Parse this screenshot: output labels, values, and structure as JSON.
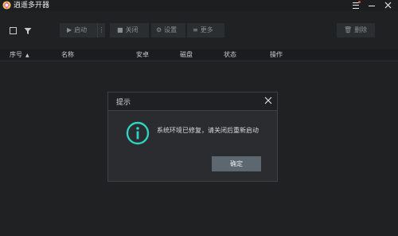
{
  "app": {
    "title": "逍遥多开器"
  },
  "toolbar": {
    "start_label": "启动",
    "close_label": "关闭",
    "settings_label": "设置",
    "more_label": "更多",
    "delete_label": "删除"
  },
  "table": {
    "columns": [
      "序号",
      "名称",
      "安卓",
      "磁盘",
      "状态",
      "操作"
    ]
  },
  "dialog": {
    "title": "提示",
    "message": "系统环境已修复，请关闭后重新启动",
    "ok_label": "确定"
  },
  "colors": {
    "background": "#1f2123",
    "accent": "#2fd1c1",
    "notification_dot": "#e0503a"
  }
}
